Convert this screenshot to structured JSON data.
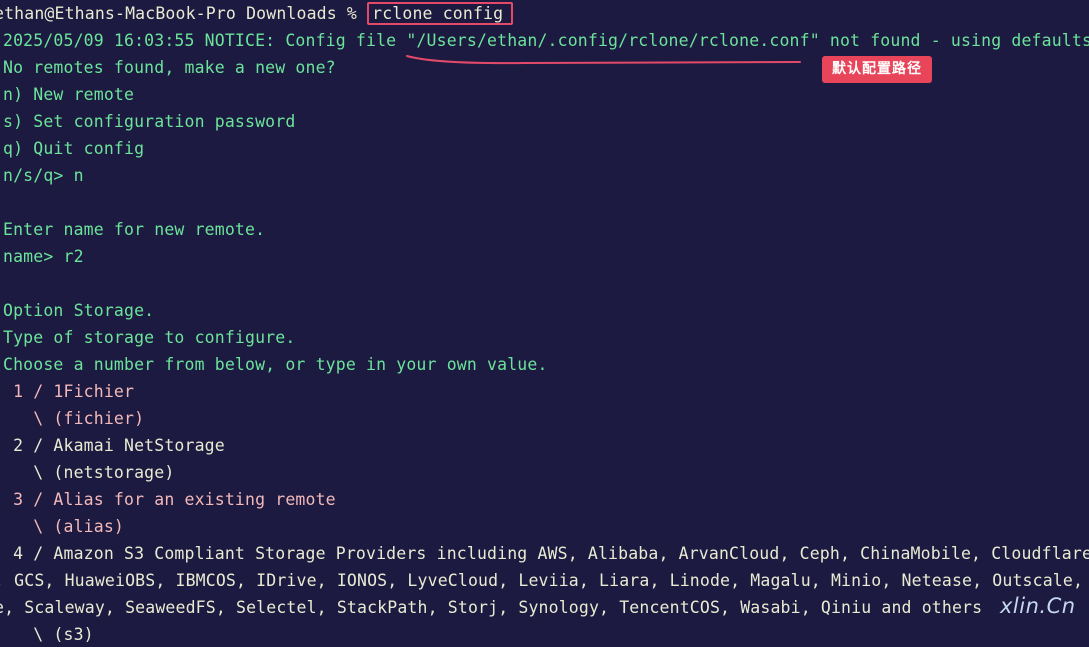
{
  "terminal": {
    "prompt": "ethan@Ethans-MacBook-Pro Downloads % ",
    "command": "rclone config",
    "notice_line": "2025/05/09 16:03:55 NOTICE: Config file \"/Users/ethan/.config/rclone/rclone.conf\" not found - using defaults",
    "no_remotes": "No remotes found, make a new one?",
    "menu_new": "n) New remote",
    "menu_set_password": "s) Set configuration password",
    "menu_quit": "q) Quit config",
    "menu_prompt": "n/s/q> n",
    "enter_name": "Enter name for new remote.",
    "name_prompt": "name> r2",
    "option_storage": "Option Storage.",
    "type_storage": "Type of storage to configure.",
    "choose_number": "Choose a number from below, or type in your own value.",
    "storage_options": [
      {
        "label": " 1 / 1Fichier",
        "value": "   \\ (fichier)"
      },
      {
        "label": " 2 / Akamai NetStorage",
        "value": "   \\ (netstorage)"
      },
      {
        "label": " 3 / Alias for an existing remote",
        "value": "   \\ (alias)"
      }
    ],
    "s3_line1": " 4 / Amazon S3 Compliant Storage Providers including AWS, Alibaba, ArvanCloud, Ceph, ChinaMobile, Cloudflare",
    "s3_line2": ", GCS, HuaweiOBS, IBMCOS, IDrive, IONOS, LyveCloud, Leviia, Liara, Linode, Magalu, Minio, Netease, Outscale,",
    "s3_line3": "e, Scaleway, SeaweedFS, Selectel, StackPath, Storj, Synology, TencentCOS, Wasabi, Qiniu and others",
    "s3_value": "   \\ (s3)"
  },
  "annotation": {
    "badge_label": "默认配置路径",
    "highlight_color": "#e34a6a"
  },
  "watermark": "xlin.Cn"
}
